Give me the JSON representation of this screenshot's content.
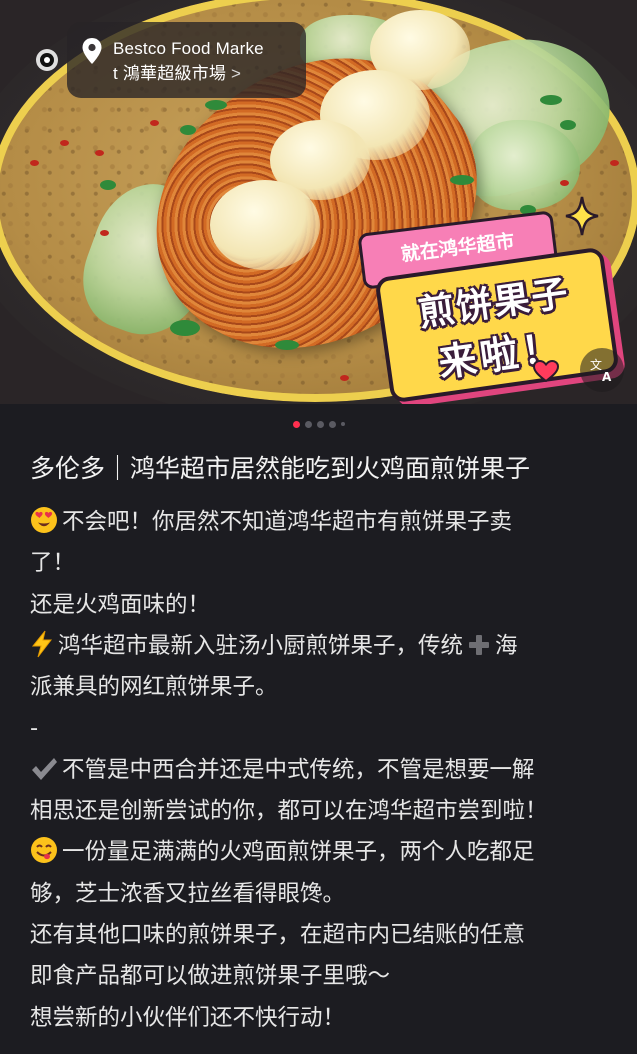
{
  "location": {
    "name_line1": "Bestco Food Marke",
    "name_line2": "t 鴻華超級市場",
    "chevron": ">",
    "icon": "location-pin-icon"
  },
  "photo": {
    "sticker_top": "就在鸿华超市",
    "sticker_line1": "煎饼果子",
    "sticker_line2": "来啦！",
    "translate_icon": "translate-icon"
  },
  "pager": {
    "total": 5,
    "active_index": 0
  },
  "post": {
    "title": "多伦多｜鸿华超市居然能吃到火鸡面煎饼果子",
    "lines": [
      {
        "emoji": "heart-eyes-emoji",
        "text": "不会吧！你居然不知道鸿华超市有煎饼果子卖"
      },
      {
        "emoji": "",
        "text": "了！"
      },
      {
        "emoji": "",
        "text": "还是火鸡面味的！"
      },
      {
        "emoji": "lightning-emoji",
        "text_a": "鸿华超市最新入驻汤小厨煎饼果子，传统",
        "text_b": "海"
      },
      {
        "emoji": "",
        "text": "派兼具的网红煎饼果子。"
      },
      {
        "emoji": "",
        "text": "-"
      },
      {
        "emoji": "check-mark-emoji",
        "text": "不管是中西合并还是中式传统，不管是想要一解"
      },
      {
        "emoji": "",
        "text": "相思还是创新尝试的你，都可以在鸿华超市尝到啦！"
      },
      {
        "emoji": "yum-face-emoji",
        "text": "一份量足满满的火鸡面煎饼果子，两个人吃都足"
      },
      {
        "emoji": "",
        "text": "够，芝士浓香又拉丝看得眼馋。"
      },
      {
        "emoji": "",
        "text": "还有其他口味的煎饼果子，在超市内已结账的任意"
      },
      {
        "emoji": "",
        "text": "即食产品都可以做进煎饼果子里哦～"
      },
      {
        "emoji": "",
        "text": "想尝新的小伙伴们还不快行动！"
      }
    ]
  },
  "colors": {
    "background": "#1c1c21",
    "pager_active": "#ff2f4f",
    "sticker_yellow": "#ffd84a",
    "sticker_pink": "#f77fb6"
  }
}
